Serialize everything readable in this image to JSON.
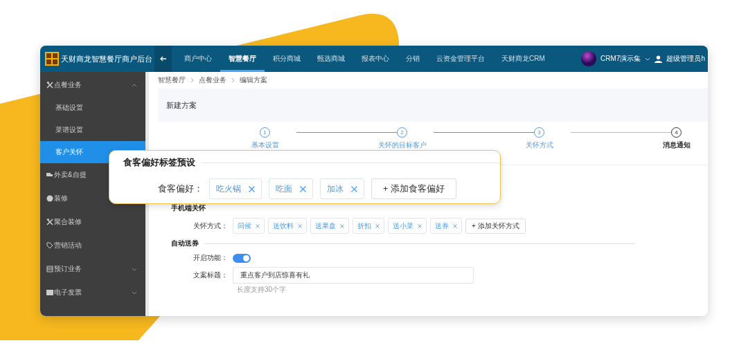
{
  "header": {
    "title": "天财商龙智慧餐厅商户后台",
    "nav": [
      {
        "label": "商户中心",
        "selected": false
      },
      {
        "label": "智慧餐厅",
        "selected": true
      },
      {
        "label": "积分商城",
        "selected": false
      },
      {
        "label": "甄选商城",
        "selected": false
      },
      {
        "label": "报表中心",
        "selected": false
      },
      {
        "label": "分销",
        "selected": false
      },
      {
        "label": "云资金管理平台",
        "selected": false
      },
      {
        "label": "天财商龙CRM",
        "selected": false
      }
    ],
    "org": "CRM7演示集",
    "user": "超级管理员h"
  },
  "sidebar": {
    "items": [
      {
        "label": "点餐业务",
        "kind": "utensils",
        "expanded": true,
        "children": [
          {
            "label": "基础设置",
            "selected": false
          },
          {
            "label": "菜谱设置",
            "selected": false
          },
          {
            "label": "客户关怀",
            "selected": true
          }
        ]
      },
      {
        "label": "外卖&自提",
        "kind": "delivery"
      },
      {
        "label": "装修",
        "kind": "palette"
      },
      {
        "label": "聚合装修",
        "kind": "utensils"
      },
      {
        "label": "营销活动",
        "kind": "tag"
      },
      {
        "label": "预订业务",
        "kind": "calendar",
        "expanded": false
      },
      {
        "label": "电子发票",
        "kind": "invoice",
        "expanded": false
      }
    ]
  },
  "breadcrumb": [
    "智慧餐厅",
    "点餐业务",
    "编辑方案"
  ],
  "page_title": "新建方案",
  "steps": [
    {
      "number": "1",
      "label": "基本设置",
      "finished": true
    },
    {
      "number": "2",
      "label": "关怀的目标客户",
      "finished": true
    },
    {
      "number": "3",
      "label": "关怀方式",
      "finished": true
    },
    {
      "number": "4",
      "label": "消息通知",
      "finished": false
    }
  ],
  "popup": {
    "title": "食客偏好标签预设",
    "label": "食客偏好：",
    "tags": [
      "吃火锅",
      "吃面",
      "加冰"
    ],
    "add_button": "+ 添加食客偏好"
  },
  "mobile_care": {
    "title": "手机端关怀",
    "label": "关怀方式：",
    "tags": [
      "问候",
      "送饮料",
      "送果盘",
      "折扣",
      "送小菜",
      "送券"
    ],
    "add_button": "+ 添加关怀方式"
  },
  "auto_coupon": {
    "title": "自动送券",
    "toggle_label": "开启功能：",
    "on": true,
    "field_label": "文案标题：",
    "field_value": "重点客户到店惊喜有礼",
    "hint": "长度支持30个字"
  }
}
